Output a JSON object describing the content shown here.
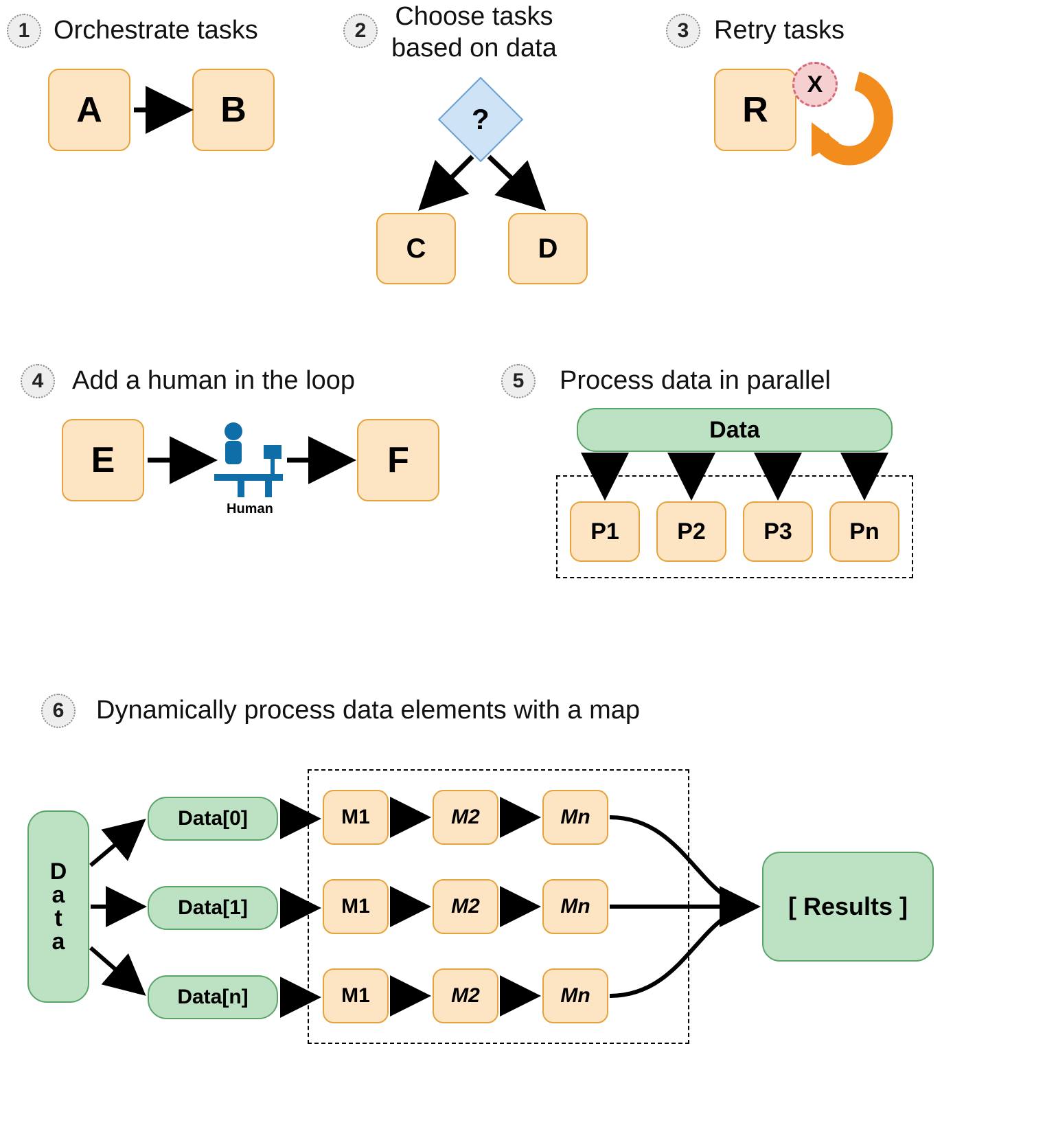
{
  "sections": {
    "s1": {
      "num": "1",
      "title": "Orchestrate tasks",
      "nodes": {
        "a": "A",
        "b": "B"
      }
    },
    "s2": {
      "num": "2",
      "title": "Choose tasks\nbased on data",
      "decision": "?",
      "nodes": {
        "c": "C",
        "d": "D"
      }
    },
    "s3": {
      "num": "3",
      "title": "Retry tasks",
      "nodes": {
        "r": "R"
      },
      "error": "X"
    },
    "s4": {
      "num": "4",
      "title": "Add a human in the loop",
      "nodes": {
        "e": "E",
        "f": "F"
      },
      "human_label": "Human"
    },
    "s5": {
      "num": "5",
      "title": "Process data in parallel",
      "data_label": "Data",
      "nodes": {
        "p1": "P1",
        "p2": "P2",
        "p3": "P3",
        "pn": "Pn"
      }
    },
    "s6": {
      "num": "6",
      "title": "Dynamically process data elements with a map",
      "data_label": "Data",
      "rows": [
        "Data[0]",
        "Data[1]",
        "Data[n]"
      ],
      "map_nodes": [
        "M1",
        "M2",
        "Mn"
      ],
      "results": "[ Results ]"
    }
  }
}
